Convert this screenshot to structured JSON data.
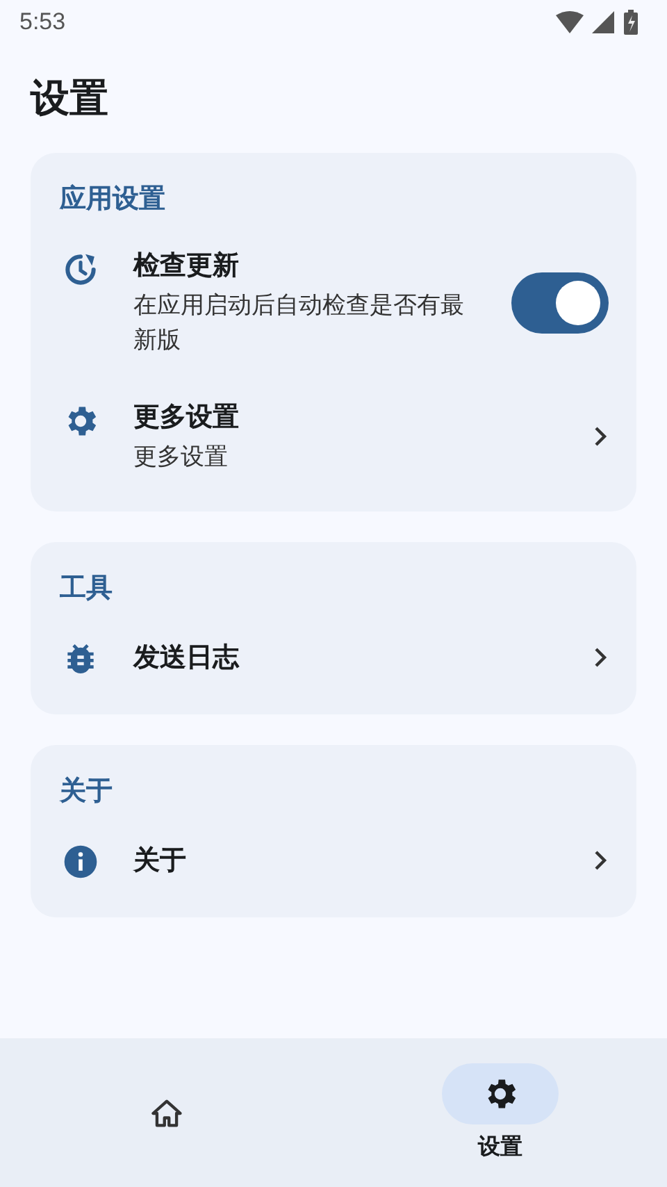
{
  "status_bar": {
    "time": "5:53"
  },
  "title": "设置",
  "sections": [
    {
      "title": "应用设置",
      "items": [
        {
          "kind": "toggle",
          "title": "检查更新",
          "subtitle": "在应用启动后自动检查是否有最新版",
          "on": true
        },
        {
          "kind": "link",
          "title": "更多设置",
          "subtitle": "更多设置"
        }
      ]
    },
    {
      "title": "工具",
      "items": [
        {
          "kind": "link",
          "title": "发送日志"
        }
      ]
    },
    {
      "title": "关于",
      "items": [
        {
          "kind": "link",
          "title": "关于"
        }
      ]
    }
  ],
  "nav": [
    {
      "selected": false
    },
    {
      "label": "设置",
      "selected": true
    }
  ]
}
